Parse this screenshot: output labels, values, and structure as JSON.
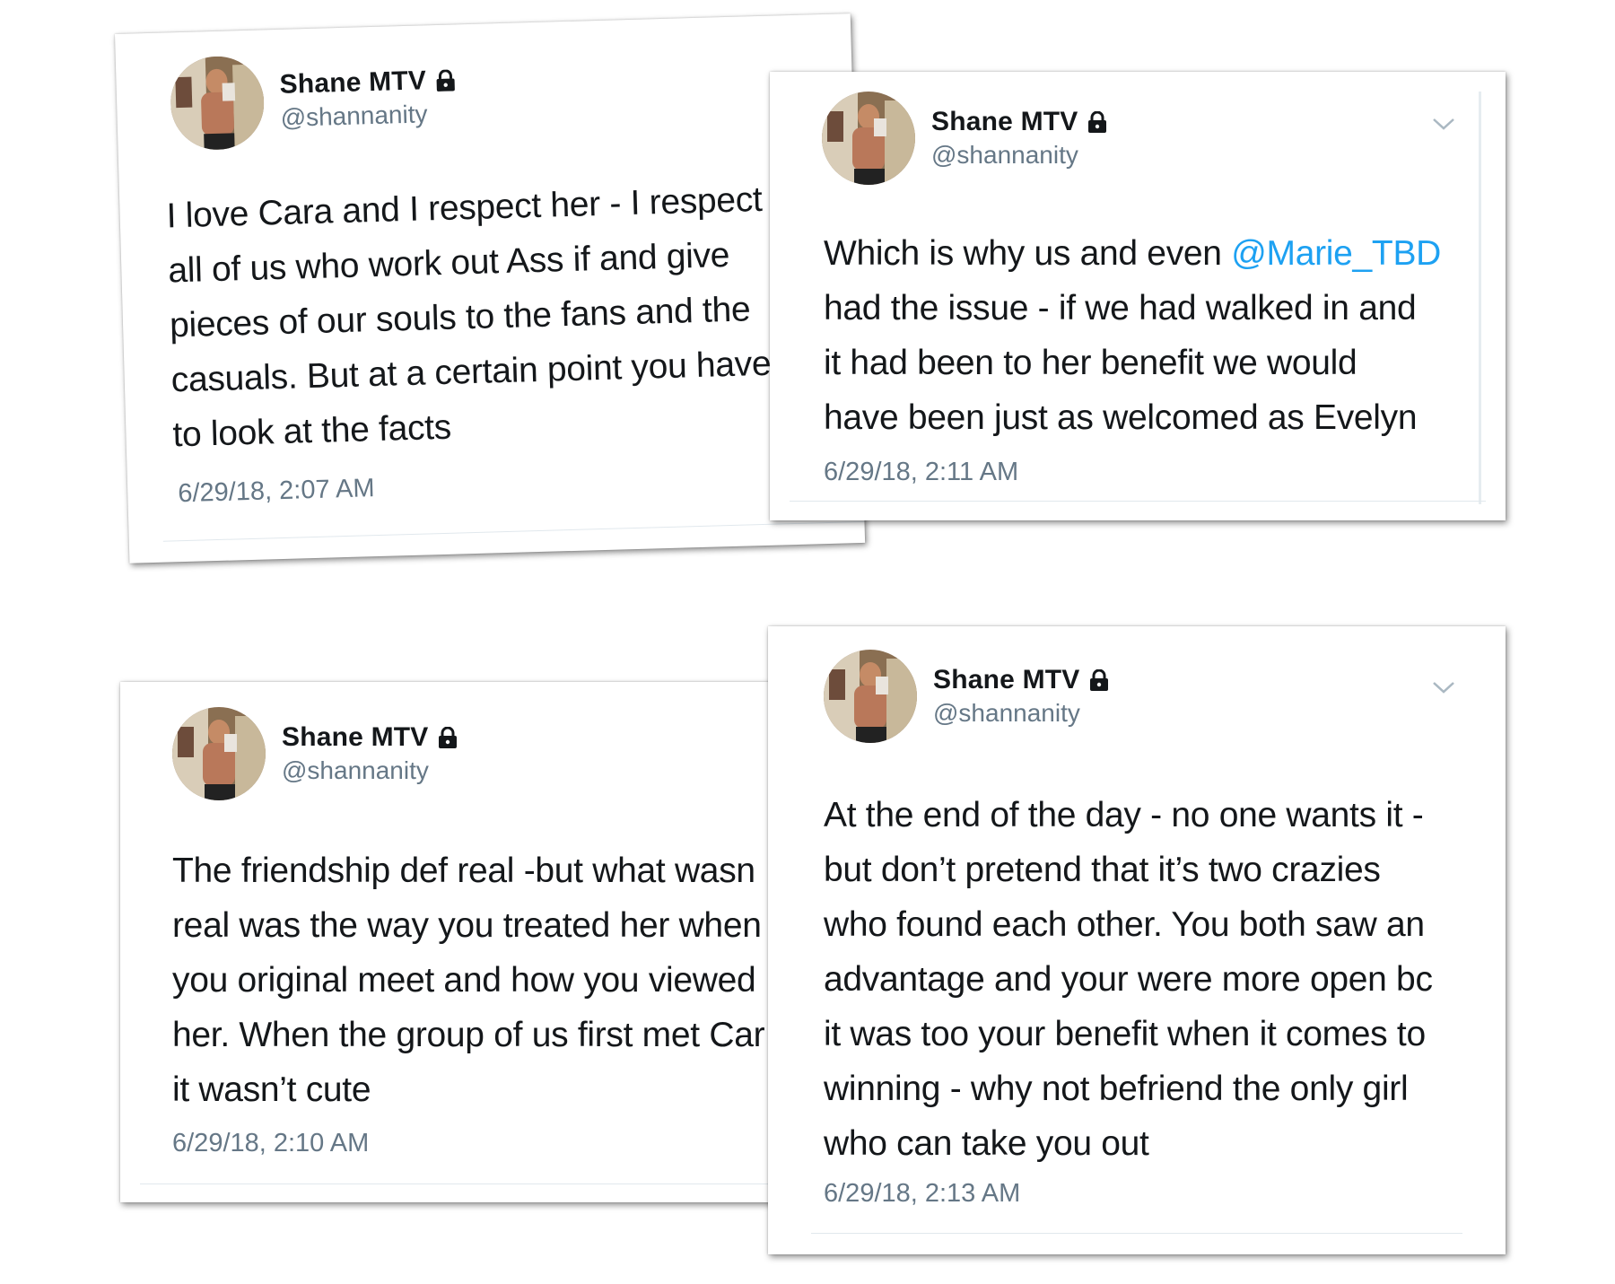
{
  "tweets": [
    {
      "name": "Shane MTV",
      "handle": "@shannanity",
      "lines": [
        "I love Cara and I respect her - I respect",
        "all of us who work out Ass if and give",
        "pieces of our souls to the fans and the",
        "casuals. But at a certain point you have",
        "to look at the facts"
      ],
      "timestamp": "6/29/18, 2:07 AM"
    },
    {
      "name": "Shane MTV",
      "handle": "@shannanity",
      "line1_prefix": "Which is why us and even ",
      "mention": "@Marie_TBD",
      "lines": [
        "had the issue - if we had walked in and",
        "it had been to her benefit we would",
        "have been just as welcomed as Evelyn"
      ],
      "timestamp": "6/29/18, 2:11 AM"
    },
    {
      "name": "Shane MTV",
      "handle": "@shannanity",
      "lines": [
        "The friendship def real -but what wasn",
        "real was the way you treated her when",
        "you original meet and how you viewed",
        "her. When the group of us first met Car",
        "it wasn’t cute"
      ],
      "timestamp": "6/29/18, 2:10 AM"
    },
    {
      "name": "Shane MTV",
      "handle": "@shannanity",
      "lines": [
        "At the end of the day - no one wants it -",
        "but don’t pretend that it’s two crazies",
        "who found each other. You both saw an",
        "advantage and your were more open bc",
        "it was too your benefit when it comes to",
        "winning - why not befriend the only girl",
        "who can take you out"
      ],
      "timestamp": "6/29/18, 2:13 AM"
    }
  ],
  "icons": {
    "lock": "lock-icon",
    "chevron": "chevron-down-icon",
    "avatar": "profile-photo"
  },
  "colors": {
    "text": "#14171a",
    "secondary": "#657786",
    "mention": "#1da1f2",
    "divider": "#e1e8ed"
  }
}
